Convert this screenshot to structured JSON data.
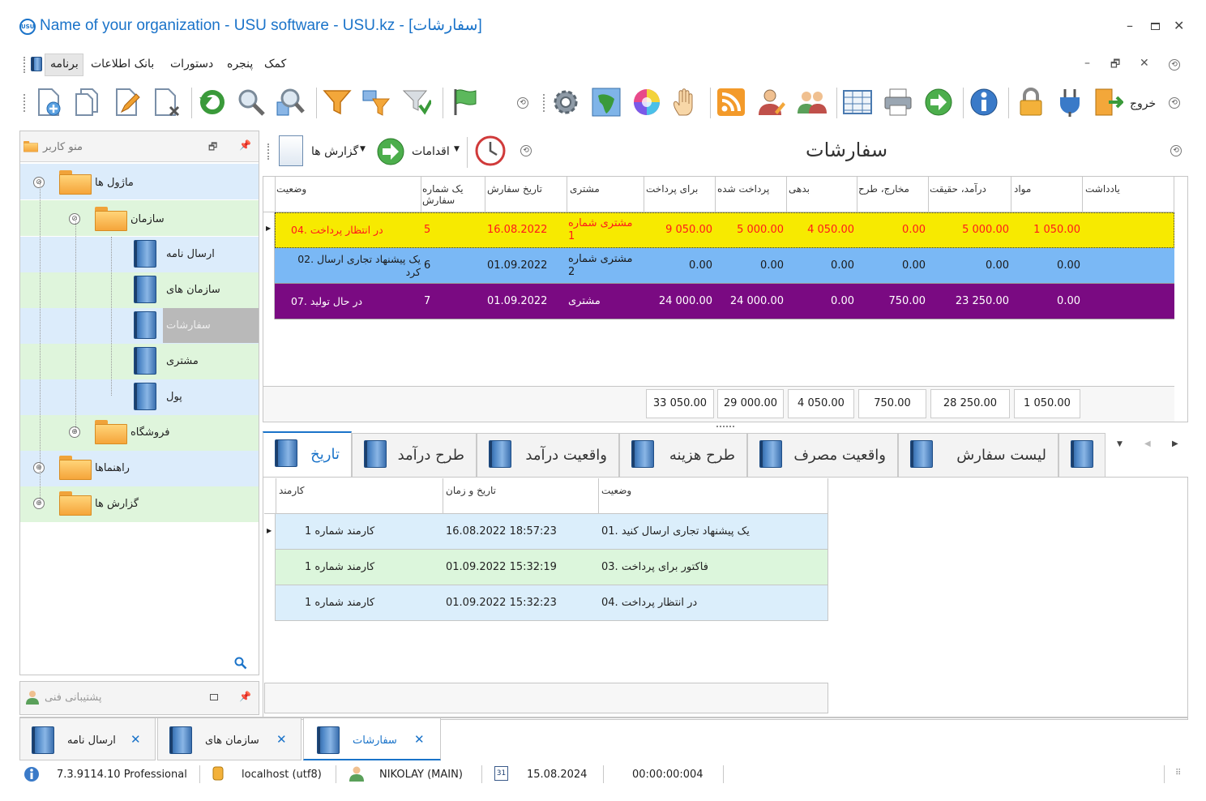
{
  "window": {
    "title": "Name of your organization - USU software - USU.kz - [سفارشات]",
    "logo": "USU"
  },
  "menu": {
    "items": [
      "برنامه",
      "بانک اطلاعات",
      "دستورات",
      "پنجره",
      "کمک"
    ]
  },
  "toolbar": {
    "exit_label": "خروج",
    "icons": [
      "add-doc-icon",
      "copy-doc-icon",
      "edit-doc-icon",
      "delete-doc-icon",
      "refresh-icon",
      "search-icon",
      "advanced-search-icon",
      "filter-icon",
      "filter-edit-icon",
      "filter-clear-icon",
      "flag-icon",
      "settings-gear-icon",
      "world-map-icon",
      "color-wheel-icon",
      "hand-icon",
      "rss-icon",
      "user-edit-icon",
      "users-icon",
      "table-icon",
      "printer-icon",
      "forward-arrow-icon",
      "info-icon",
      "lock-icon",
      "plug-icon",
      "exit-door-icon"
    ]
  },
  "sidebar": {
    "title": "منو کاربر",
    "tree": {
      "modules": "ماژول ها",
      "organization": "سازمان",
      "items": [
        "ارسال نامه",
        "سازمان های",
        "سفارشات",
        "مشتری",
        "پول"
      ],
      "store": "فروشگاه",
      "guides": "راهنماها",
      "reports": "گزارش ها"
    },
    "support": "پشتیبانی فنی"
  },
  "panel": {
    "title": "سفارشات",
    "reports_label": "گزارش ها",
    "actions_label": "اقدامات"
  },
  "grid": {
    "columns": [
      "وضعیت",
      "یک شماره سفارش",
      "تاریخ سفارش",
      "مشتری",
      "برای پرداخت",
      "پرداخت شده",
      "بدهی",
      "مخارج، طرح",
      "درآمد، حقیقت",
      "مواد",
      "یادداشت"
    ],
    "rows": [
      {
        "status": "04. در انتظار پرداخت",
        "num": "5",
        "date": "16.08.2022",
        "customer": "مشتری شماره 1",
        "to_pay": "9 050.00",
        "paid": "5 000.00",
        "debt": "4 050.00",
        "exp": "0.00",
        "income": "5 000.00",
        "materials": "1 050.00",
        "bg": "#f7ea00",
        "fg": "#ff1a1a"
      },
      {
        "status": "02. یک پیشنهاد تجاری ارسال کرد",
        "num": "6",
        "date": "01.09.2022",
        "customer": "مشتری شماره 2",
        "to_pay": "0.00",
        "paid": "0.00",
        "debt": "0.00",
        "exp": "0.00",
        "income": "0.00",
        "materials": "0.00",
        "bg": "#7ab8f5",
        "fg": "#1a1a1a"
      },
      {
        "status": "07. در حال تولید",
        "num": "7",
        "date": "01.09.2022",
        "customer": "مشتری",
        "to_pay": "24 000.00",
        "paid": "24 000.00",
        "debt": "0.00",
        "exp": "750.00",
        "income": "23 250.00",
        "materials": "0.00",
        "bg": "#7a0a82",
        "fg": "#ffffff"
      }
    ],
    "totals": [
      "33 050.00",
      "29 000.00",
      "4 050.00",
      "750.00",
      "28 250.00",
      "1 050.00"
    ]
  },
  "tabs": [
    "تاریخ",
    "طرح درآمد",
    "واقعیت درآمد",
    "طرح هزینه",
    "واقعیت مصرف",
    "لیست سفارش"
  ],
  "subgrid": {
    "columns": [
      "کارمند",
      "تاریخ و زمان",
      "وضعیت"
    ],
    "rows": [
      {
        "employee": "کارمند شماره 1",
        "datetime": "16.08.2022 18:57:23",
        "status": "01. یک پیشنهاد تجاری ارسال کنید",
        "bg": "#dbeefb"
      },
      {
        "employee": "کارمند شماره 1",
        "datetime": "01.09.2022 15:32:19",
        "status": "03. فاکتور برای پرداخت",
        "bg": "#dcf6dc"
      },
      {
        "employee": "کارمند شماره 1",
        "datetime": "01.09.2022 15:32:23",
        "status": "04. در انتظار پرداخت",
        "bg": "#dbeefb"
      }
    ]
  },
  "window_tabs": [
    "ارسال نامه",
    "سازمان های",
    "سفارشات"
  ],
  "status": {
    "version": "7.3.9114.10 Professional",
    "db": "localhost (utf8)",
    "user": "NIKOLAY (MAIN)",
    "date": "15.08.2024",
    "timer": "00:00:00:004",
    "calendar_day": "31"
  },
  "colors": {
    "accent": "#1a73c9",
    "tree_blue": "#dcecfb",
    "tree_green": "#dff5dc"
  }
}
